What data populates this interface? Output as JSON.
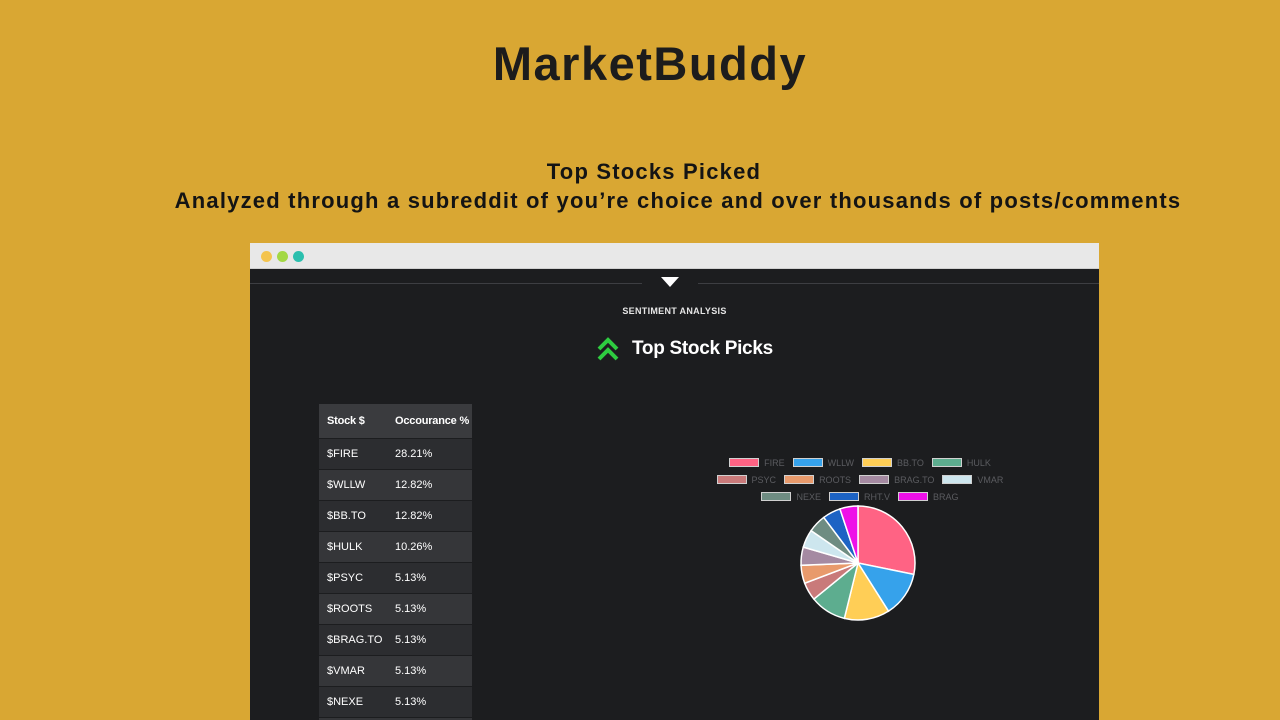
{
  "app": {
    "title": "MarketBuddy"
  },
  "intro": {
    "headline": "Top Stocks Picked",
    "subline": "Analyzed through a subreddit of you’re choice and over thousands of posts/comments"
  },
  "panel": {
    "section_label": "SENTIMENT ANALYSIS",
    "heading": "Top Stock Picks",
    "heading_icon": "double-chevron-up-icon",
    "accent": "#2ecc40"
  },
  "table": {
    "headers": [
      "Stock $",
      "Occourance %"
    ],
    "rows": [
      [
        "$FIRE",
        "28.21%"
      ],
      [
        "$WLLW",
        "12.82%"
      ],
      [
        "$BB.TO",
        "12.82%"
      ],
      [
        "$HULK",
        "10.26%"
      ],
      [
        "$PSYC",
        "5.13%"
      ],
      [
        "$ROOTS",
        "5.13%"
      ],
      [
        "$BRAG.TO",
        "5.13%"
      ],
      [
        "$VMAR",
        "5.13%"
      ],
      [
        "$NEXE",
        "5.13%"
      ]
    ]
  },
  "chart_data": {
    "type": "pie",
    "legend_rows": [
      [
        0,
        1,
        2,
        3
      ],
      [
        4,
        5,
        6,
        7
      ],
      [
        8,
        9,
        10
      ]
    ],
    "slices": [
      {
        "label": "FIRE",
        "value": 28.21,
        "color": "#ff6384"
      },
      {
        "label": "WLLW",
        "value": 12.82,
        "color": "#36a2eb"
      },
      {
        "label": "BB.TO",
        "value": 12.82,
        "color": "#ffce56"
      },
      {
        "label": "HULK",
        "value": 10.26,
        "color": "#5dad8f"
      },
      {
        "label": "PSYC",
        "value": 5.13,
        "color": "#c97a7a"
      },
      {
        "label": "ROOTS",
        "value": 5.13,
        "color": "#e89a6c"
      },
      {
        "label": "BRAG.TO",
        "value": 5.13,
        "color": "#a58aa2"
      },
      {
        "label": "VMAR",
        "value": 5.13,
        "color": "#cde6ee"
      },
      {
        "label": "NEXE",
        "value": 5.13,
        "color": "#6e8c82"
      },
      {
        "label": "RHT.V",
        "value": 5.13,
        "color": "#1d63c4"
      },
      {
        "label": "BRAG",
        "value": 5.13,
        "color": "#ee10e8"
      }
    ]
  }
}
